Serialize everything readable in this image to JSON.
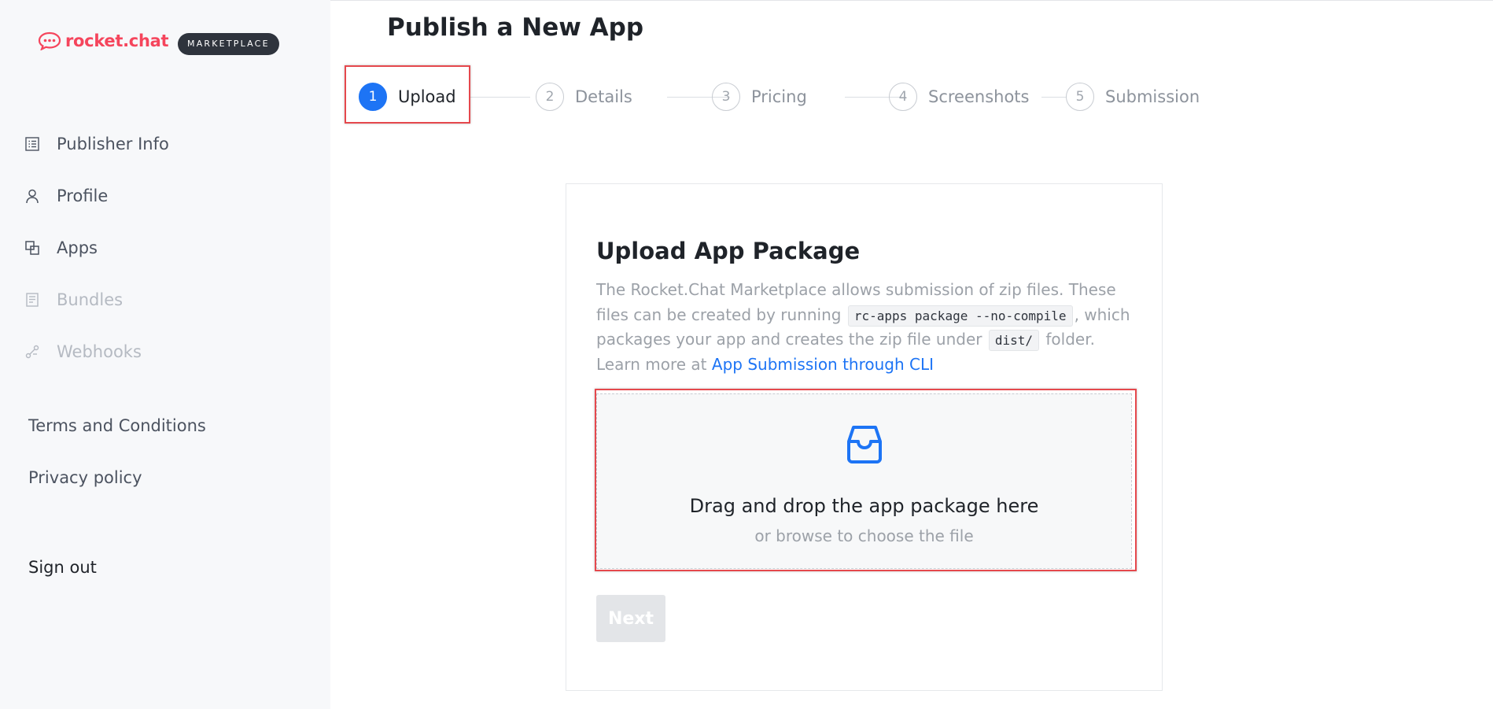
{
  "brand": {
    "name": "rocket.chat",
    "badge": "MARKETPLACE",
    "color": "#f5455c"
  },
  "sidebar": {
    "items": [
      {
        "label": "Publisher Info",
        "icon": "list-icon",
        "disabled": false
      },
      {
        "label": "Profile",
        "icon": "user-icon",
        "disabled": false
      },
      {
        "label": "Apps",
        "icon": "apps-icon",
        "disabled": false
      },
      {
        "label": "Bundles",
        "icon": "bundle-icon",
        "disabled": true
      },
      {
        "label": "Webhooks",
        "icon": "webhook-icon",
        "disabled": true
      }
    ],
    "links": [
      {
        "label": "Terms and Conditions"
      },
      {
        "label": "Privacy policy"
      }
    ],
    "sign_out": "Sign out"
  },
  "main": {
    "title": "Publish a New App",
    "steps": [
      {
        "num": "1",
        "label": "Upload",
        "active": true
      },
      {
        "num": "2",
        "label": "Details",
        "active": false
      },
      {
        "num": "3",
        "label": "Pricing",
        "active": false
      },
      {
        "num": "4",
        "label": "Screenshots",
        "active": false
      },
      {
        "num": "5",
        "label": "Submission",
        "active": false
      }
    ]
  },
  "card": {
    "title": "Upload App Package",
    "desc_1": "The Rocket.Chat Marketplace allows submission of zip files. These files can be created by running",
    "code_1": "rc-apps package --no-compile",
    "desc_2": ", which packages your app and creates the zip file under",
    "code_2": "dist/",
    "desc_3": "folder.",
    "learn_prefix": "Learn more at",
    "learn_link": "App Submission through CLI",
    "dropzone_title": "Drag and drop the app package here",
    "dropzone_sub": "or browse to choose the file",
    "next": "Next"
  },
  "colors": {
    "accent": "#1d74f5",
    "highlight": "#e5484d"
  }
}
